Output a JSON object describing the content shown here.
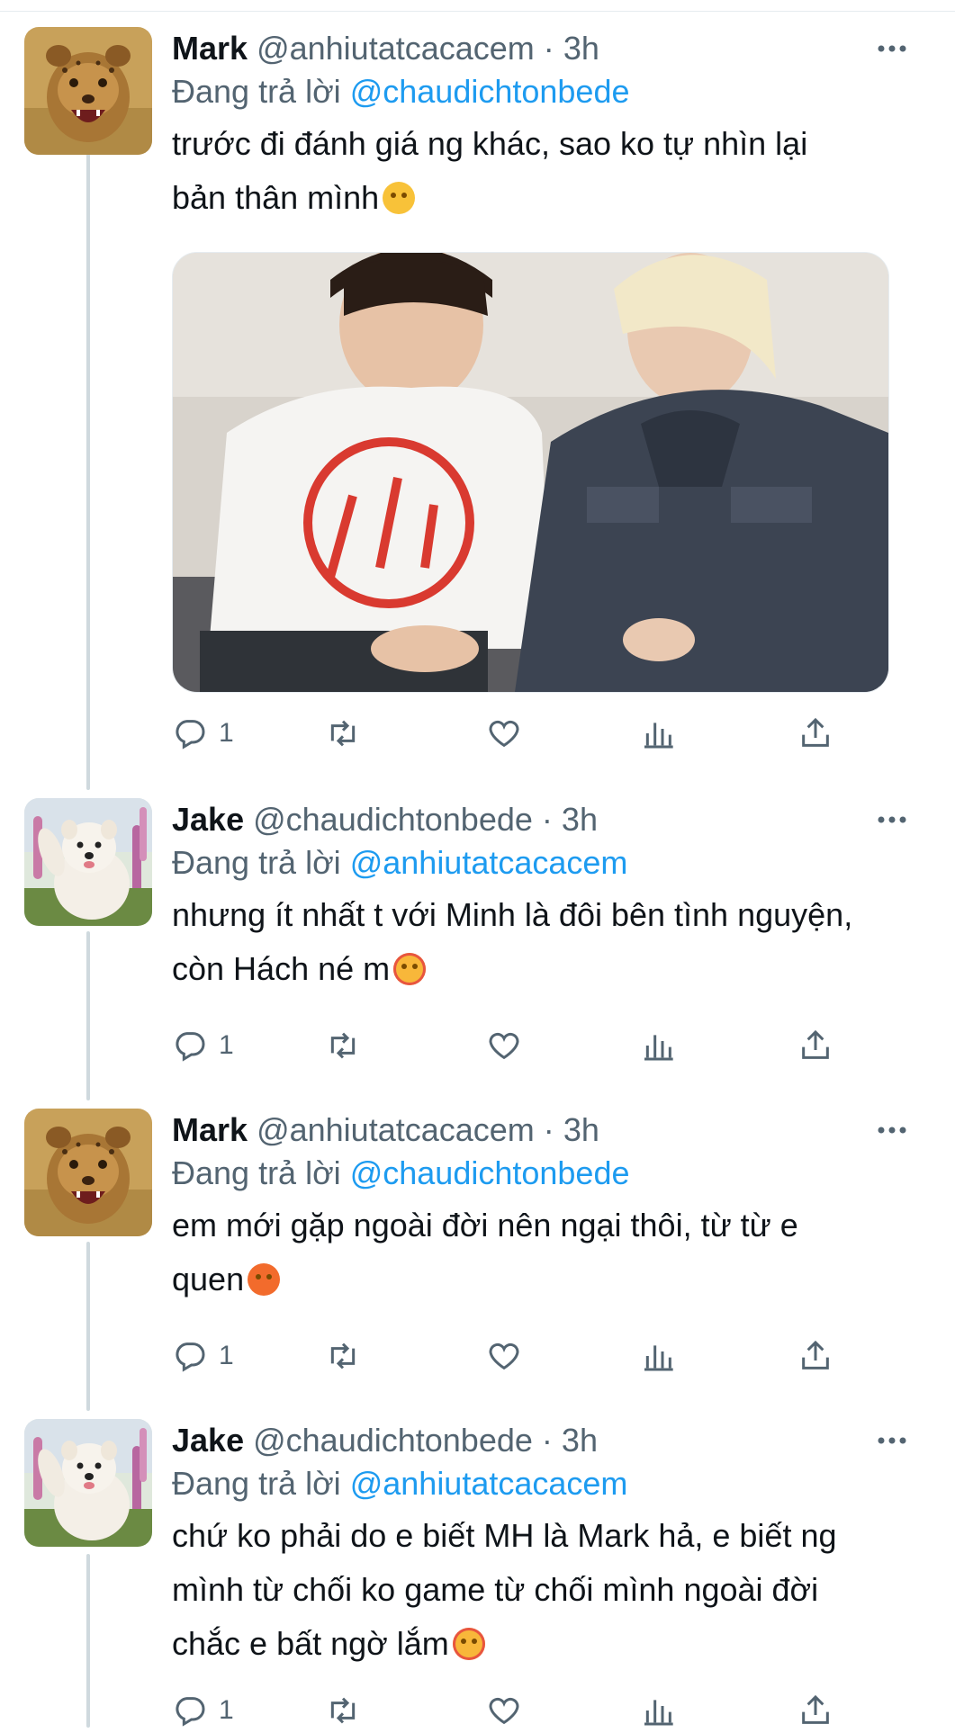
{
  "tweets": [
    {
      "name": "Mark",
      "handle": "@anhiutatcacacem",
      "dot": "·",
      "time": "3h",
      "reply_prefix": "Đang trả lời",
      "reply_to": "@chaudichtonbede",
      "text_lines": [
        "trước đi đánh giá ng khác, sao ko tự nhìn lại",
        "bản thân mình"
      ],
      "emoji": "smiling-face",
      "has_photo": true,
      "replies": "1",
      "avatar": "cheetah-cub"
    },
    {
      "name": "Jake",
      "handle": "@chaudichtonbede",
      "dot": "·",
      "time": "3h",
      "reply_prefix": "Đang trả lời",
      "reply_to": "@anhiutatcacacem",
      "text_lines": [
        "nhưng ít nhất t với Minh là đôi bên tình nguyện,",
        "còn Hách né m"
      ],
      "emoji": "smiling-face-with-hearts",
      "has_photo": false,
      "replies": "1",
      "avatar": "white-dog"
    },
    {
      "name": "Mark",
      "handle": "@anhiutatcacacem",
      "dot": "·",
      "time": "3h",
      "reply_prefix": "Đang trả lời",
      "reply_to": "@chaudichtonbede",
      "text_lines": [
        "em mới gặp ngoài đời nên ngại thôi, từ từ e",
        "quen"
      ],
      "emoji": "angry-face",
      "has_photo": false,
      "replies": "1",
      "avatar": "cheetah-cub"
    },
    {
      "name": "Jake",
      "handle": "@chaudichtonbede",
      "dot": "·",
      "time": "3h",
      "reply_prefix": "Đang trả lời",
      "reply_to": "@anhiutatcacacem",
      "text_lines": [
        "chứ ko phải do e biết MH là Mark hả, e biết ng",
        "mình từ chối ko game từ chối mình ngoài đời",
        "chắc e bất ngờ lắm"
      ],
      "emoji": "smiling-face-with-hearts",
      "has_photo": false,
      "replies": "1",
      "avatar": "white-dog"
    }
  ],
  "icons": {
    "reply": "reply-icon",
    "retweet": "retweet-icon",
    "like": "like-icon",
    "views": "views-icon",
    "share": "share-icon",
    "more": "more-icon"
  },
  "colors": {
    "link": "#1d9bf0",
    "secondary": "#536471",
    "text": "#0f1419",
    "thread_line": "#cfd9de"
  }
}
